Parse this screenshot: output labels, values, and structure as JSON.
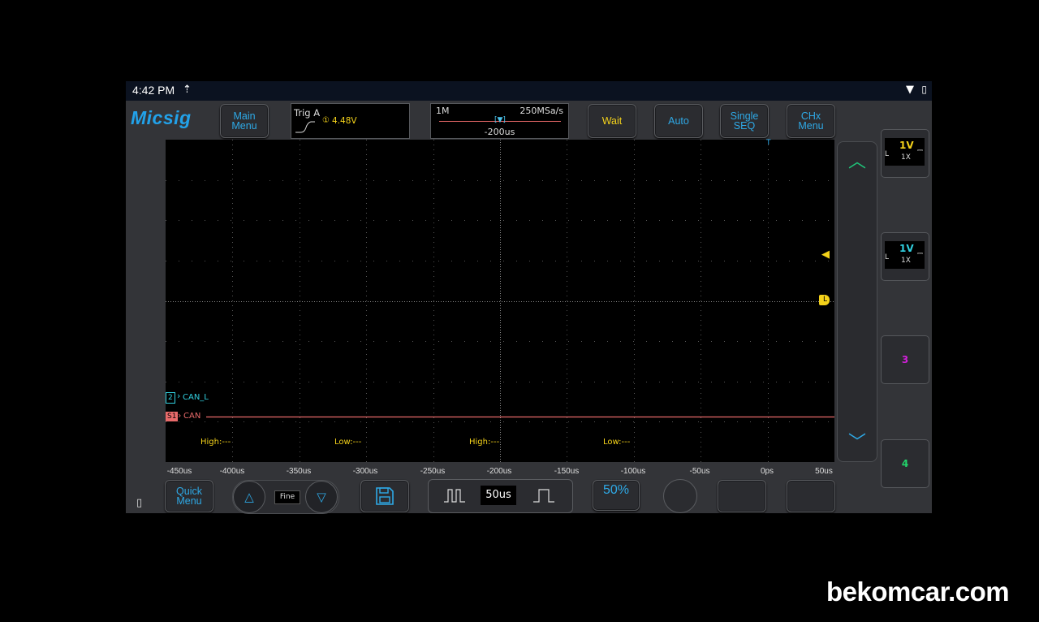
{
  "status": {
    "time": "4:42 PM",
    "upload_icon": "upload-arrow-icon",
    "wifi_icon": "wifi-icon",
    "battery_icon": "battery-charging-icon"
  },
  "header": {
    "logo": "Micsig",
    "main_menu": "Main\nMenu",
    "trigger": {
      "label": "Trig A",
      "level": "4.48V"
    },
    "timebar": {
      "memory_depth": "1M",
      "sample_rate": "250MSa/s",
      "offset": "-200us"
    },
    "wait_label": "Wait",
    "auto_label": "Auto",
    "single_label": "Single\nSEQ",
    "chx_label": "CHx\nMenu"
  },
  "screen": {
    "ch2_number": "2",
    "ch2_label": "CAN_L",
    "s1_number": "S1",
    "s1_label": "CAN",
    "trigger_marker": "T",
    "level_marker": "L",
    "decode_labels": [
      "High:---",
      "Low:---",
      "High:---",
      "Low:---"
    ],
    "x_axis": [
      "-450us",
      "-400us",
      "-350us",
      "-300us",
      "-250us",
      "-200us",
      "-150us",
      "-100us",
      "-50us",
      "0ps",
      "50us"
    ]
  },
  "channels": [
    {
      "number": "1",
      "scale": "1V",
      "probe": "1X",
      "coupling": "L",
      "color": "#f4d21a"
    },
    {
      "number": "2",
      "scale": "1V",
      "probe": "1X",
      "coupling": "L",
      "color": "#31d0e0"
    },
    {
      "number": "3",
      "color": "#d020d8"
    },
    {
      "number": "4",
      "color": "#22d46a"
    }
  ],
  "bottom": {
    "quick_menu": "Quick\nMenu",
    "fine_label": "Fine",
    "timebase": "50us",
    "percent_label": "50%"
  },
  "colors": {
    "ch1": "#f4d21a",
    "ch2": "#31d0e0",
    "serial": "#e86a6a",
    "accent": "#2ea9e6"
  },
  "watermark": "bekomcar.com"
}
